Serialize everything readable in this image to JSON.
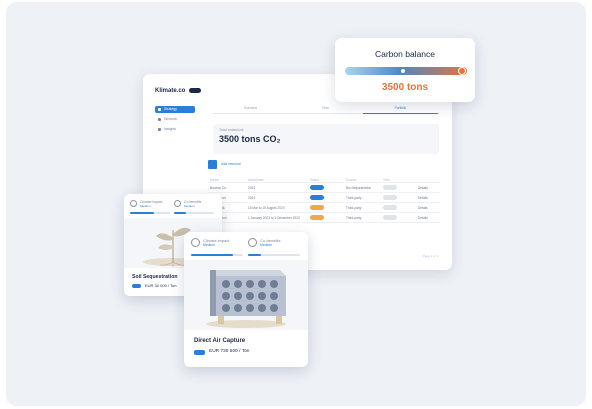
{
  "dashboard": {
    "logo": "Klimate.co",
    "sidebar": [
      "Strategy",
      "Network",
      "Insights"
    ],
    "tabs": [
      "Overview",
      "Plan",
      "Portfolio"
    ],
    "total_label": "Total emissions",
    "total_value": "3500 tons CO₂",
    "action_label": "Add removal",
    "table": {
      "headers": [
        "Name",
        "Description",
        "Status",
        "Source",
        "Tons"
      ],
      "rows": [
        [
          "Biochar Co.",
          "2023",
          "Certified",
          "Bio Sequestration",
          "Details"
        ],
        [
          "Air Capture",
          "2024",
          "Pending",
          "Third-party",
          "Details"
        ],
        [
          "Ocean Alk.",
          "15 Mar to 15 August 2023",
          "Pending",
          "Third-party",
          "Details"
        ],
        [
          "Soil Carbon",
          "1 January 2023 to 1 December 2023",
          "Pending",
          "Third-party",
          "Details"
        ]
      ],
      "status_colors": [
        "blue",
        "blue",
        "orange",
        "orange"
      ]
    },
    "pager": "Page 1 of 1"
  },
  "carbon": {
    "title": "Carbon balance",
    "value": "3500 tons",
    "gradient": [
      "#a7d4f0",
      "#4e88c5",
      "#e3743e"
    ]
  },
  "card1": {
    "metric_a": "Climate impact",
    "metric_a_sub": "Medium",
    "metric_b": "Co-benefits",
    "metric_b_sub": "Medium",
    "progress_a": 0.6,
    "progress_b": 0.3,
    "title": "Soil Sequestration",
    "price": "EUR 30 000 / Ton"
  },
  "card2": {
    "metric_a": "Climate impact",
    "metric_a_sub": "Medium",
    "metric_b": "Co-benefits",
    "metric_b_sub": "Medium",
    "progress_a": 0.8,
    "progress_b": 0.25,
    "title": "Direct Air Capture",
    "price": "EUR 730 500 / Ton"
  }
}
